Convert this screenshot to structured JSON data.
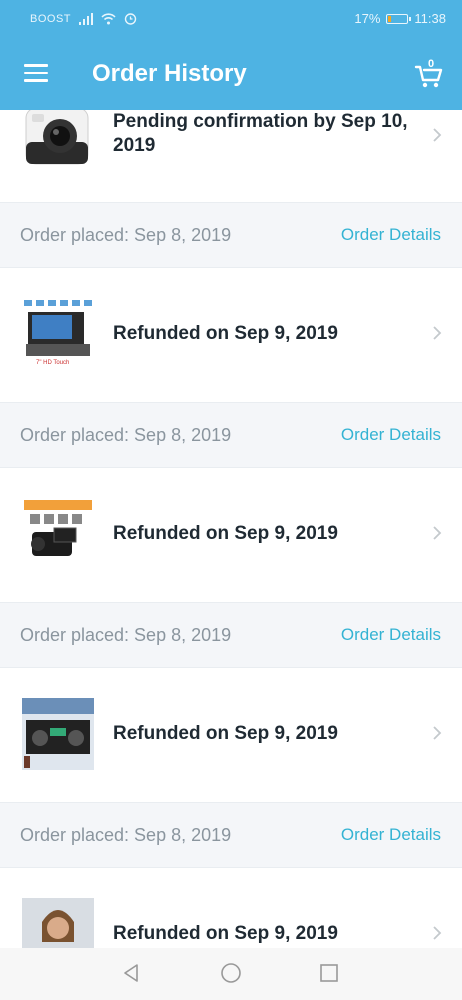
{
  "status_bar": {
    "carrier": "BOOST",
    "battery_percent": "17%",
    "battery_level": 0.17,
    "time": "11:38"
  },
  "app_bar": {
    "title": "Order History",
    "cart_count": "0"
  },
  "first_item": {
    "status": "Pending confirmation by Sep 10, 2019",
    "thumb_icon": "instant-camera-icon"
  },
  "orders": [
    {
      "placed": "Order placed: Sep 8, 2019",
      "details_label": "Order Details",
      "status": "Refunded on Sep 9, 2019",
      "thumb_icon": "car-stereo-icon"
    },
    {
      "placed": "Order placed: Sep 8, 2019",
      "details_label": "Order Details",
      "status": "Refunded on Sep 9, 2019",
      "thumb_icon": "video-camera-icon"
    },
    {
      "placed": "Order placed: Sep 8, 2019",
      "details_label": "Order Details",
      "status": "Refunded on Sep 9, 2019",
      "thumb_icon": "amplifier-icon"
    },
    {
      "placed": "Order placed: Sep 8, 2019",
      "details_label": "Order Details",
      "status": "Refunded on Sep 9, 2019",
      "thumb_icon": "person-photo-icon"
    }
  ],
  "colors": {
    "header": "#4eb3e3",
    "link": "#34b3d3",
    "separator_bg": "#f4f6f9"
  }
}
